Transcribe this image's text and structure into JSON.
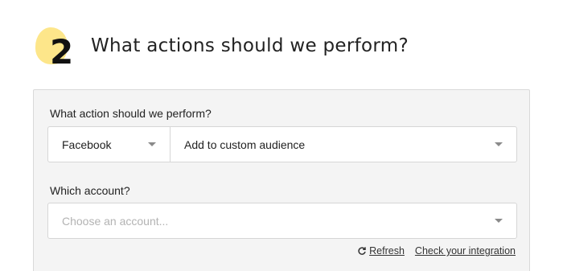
{
  "step": {
    "number": "2",
    "title": "What actions should we perform?",
    "accent_color": "#fde68a"
  },
  "action_field": {
    "label": "What action should we perform?",
    "app_value": "Facebook",
    "action_value": "Add to custom audience"
  },
  "account_field": {
    "label": "Which account?",
    "placeholder": "Choose an account..."
  },
  "links": {
    "refresh": "Refresh",
    "check_integration": "Check your integration"
  },
  "icons": {
    "step_blob": "highlight-blob",
    "caret": "chevron-down-icon",
    "refresh": "refresh-icon"
  }
}
